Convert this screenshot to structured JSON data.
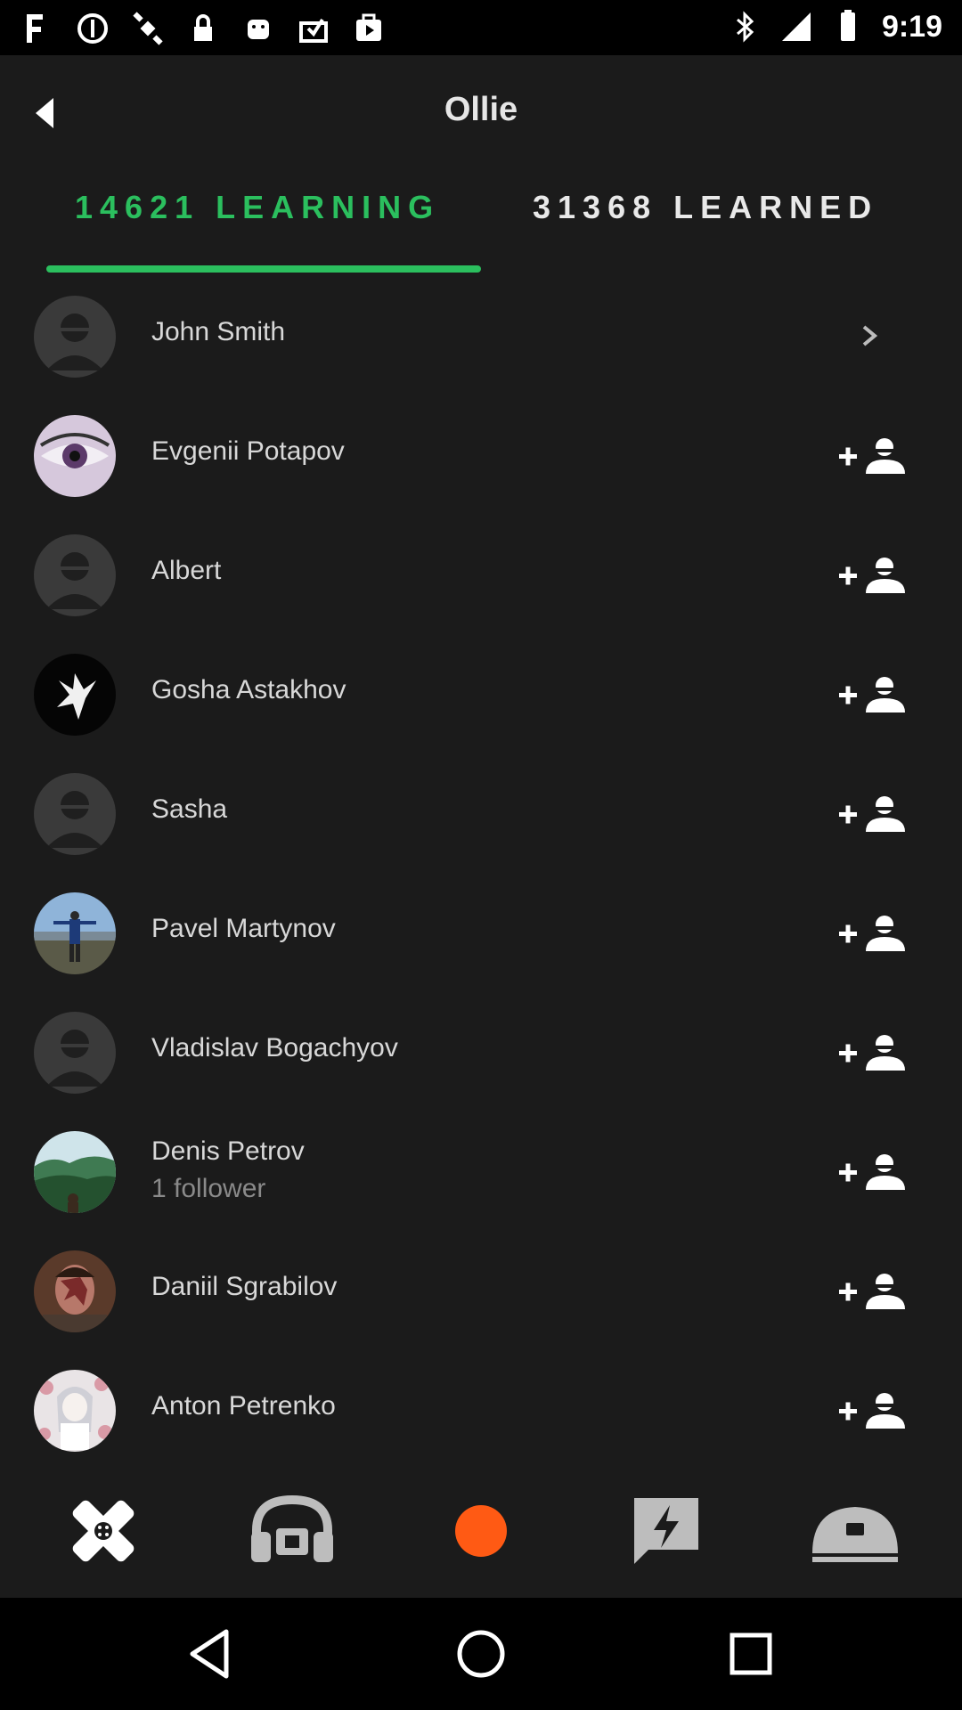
{
  "status_bar": {
    "time": "9:19",
    "left_icons": [
      "fake-gps-icon",
      "do-not-disturb-icon",
      "satellite-icon",
      "lock-icon",
      "android-icon",
      "mailbox-icon",
      "play-store-icon"
    ],
    "right_icons": [
      "bluetooth-icon",
      "signal-icon",
      "battery-icon"
    ]
  },
  "header": {
    "title": "Ollie"
  },
  "tabs": [
    {
      "label": "14621 LEARNING",
      "active": true
    },
    {
      "label": "31368 LEARNED",
      "active": false
    }
  ],
  "colors": {
    "accent": "#2bbf5e",
    "record": "#ff5a14",
    "background": "#1b1b1b"
  },
  "users": [
    {
      "name": "John Smith",
      "action": "chevron-right-icon",
      "avatar": "default"
    },
    {
      "name": "Evgenii Potapov",
      "action": "add-friend-icon",
      "avatar": "eye"
    },
    {
      "name": "Albert",
      "action": "add-friend-icon",
      "avatar": "default"
    },
    {
      "name": "Gosha Astakhov",
      "action": "add-friend-icon",
      "avatar": "dove"
    },
    {
      "name": "Sasha",
      "action": "add-friend-icon",
      "avatar": "default"
    },
    {
      "name": "Pavel Martynov",
      "action": "add-friend-icon",
      "avatar": "person-outdoor"
    },
    {
      "name": "Vladislav Bogachyov",
      "action": "add-friend-icon",
      "avatar": "default"
    },
    {
      "name": "Denis Petrov",
      "subtitle": "1 follower",
      "action": "add-friend-icon",
      "avatar": "forest"
    },
    {
      "name": "Daniil Sgrabilov",
      "action": "add-friend-icon",
      "avatar": "face"
    },
    {
      "name": "Anton Petrenko",
      "action": "add-friend-icon",
      "avatar": "anime"
    }
  ],
  "bottom_nav": [
    "tools-icon",
    "headphones-icon",
    "record-icon",
    "lightning-chat-icon",
    "user-profile-icon"
  ],
  "system_nav": [
    "back-triangle-icon",
    "home-circle-icon",
    "recents-square-icon"
  ]
}
